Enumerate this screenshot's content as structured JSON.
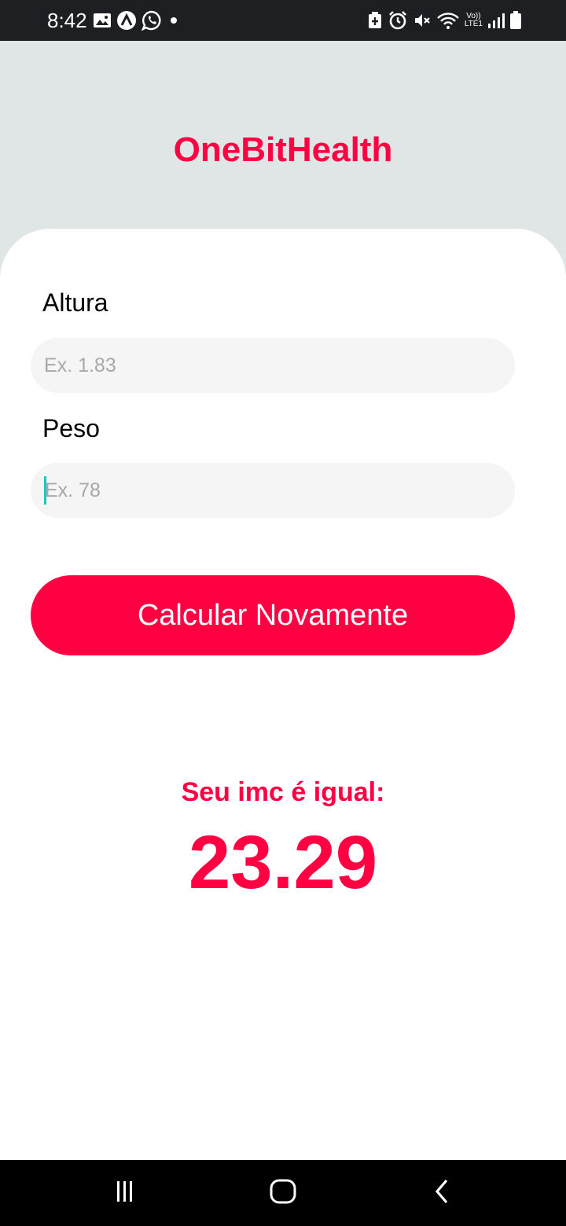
{
  "colors": {
    "accent": "#FF0043",
    "header_bg": "#E0E5E5",
    "input_bg": "#F5F5F5",
    "placeholder": "#A8A8A8",
    "caret": "#1EC8B8",
    "status_bar_bg": "#1E1F23",
    "nav_bar_bg": "#000000"
  },
  "status_bar": {
    "time": "8:42",
    "left_icons": [
      "gallery-icon",
      "app-a-icon",
      "whatsapp-icon",
      "dot-icon"
    ],
    "right_icons": [
      "battery-saver-icon",
      "alarm-icon",
      "mute-icon",
      "wifi-icon",
      "volte-lte-icon",
      "signal-icon",
      "battery-icon"
    ],
    "volte_label": "Vo))",
    "lte_label": "LTE1"
  },
  "header": {
    "title": "OneBitHealth"
  },
  "form": {
    "height_label": "Altura",
    "height_placeholder": "Ex. 1.83",
    "weight_label": "Peso",
    "weight_placeholder": "Ex. 78",
    "button_label": "Calcular Novamente"
  },
  "result": {
    "label": "Seu imc é igual:",
    "value": "23.29"
  },
  "nav_bar": {
    "buttons": [
      "recents-icon",
      "home-icon",
      "back-icon"
    ]
  }
}
